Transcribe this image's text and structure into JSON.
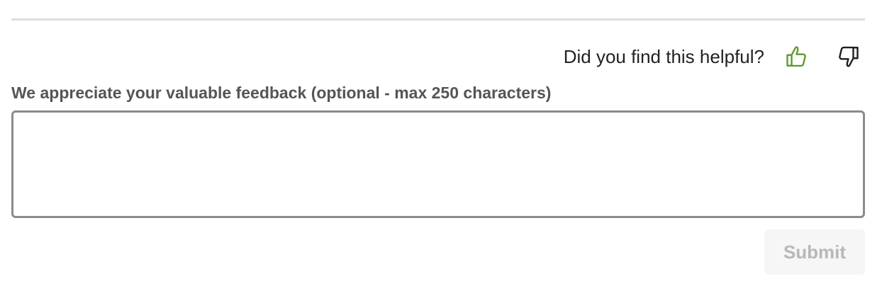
{
  "feedback": {
    "question": "Did you find this helpful?",
    "label": "We appreciate your valuable feedback (optional - max 250 characters)",
    "textarea_value": "",
    "submit_label": "Submit",
    "thumbs_up_icon": "thumbs-up-icon",
    "thumbs_down_icon": "thumbs-down-icon",
    "colors": {
      "thumbs_up": "#5f9a2e",
      "thumbs_down": "#1f1f1f",
      "submit_disabled_text": "#b8b8b8",
      "submit_disabled_bg": "#f6f6f6",
      "textarea_border": "#8a8a90"
    }
  }
}
